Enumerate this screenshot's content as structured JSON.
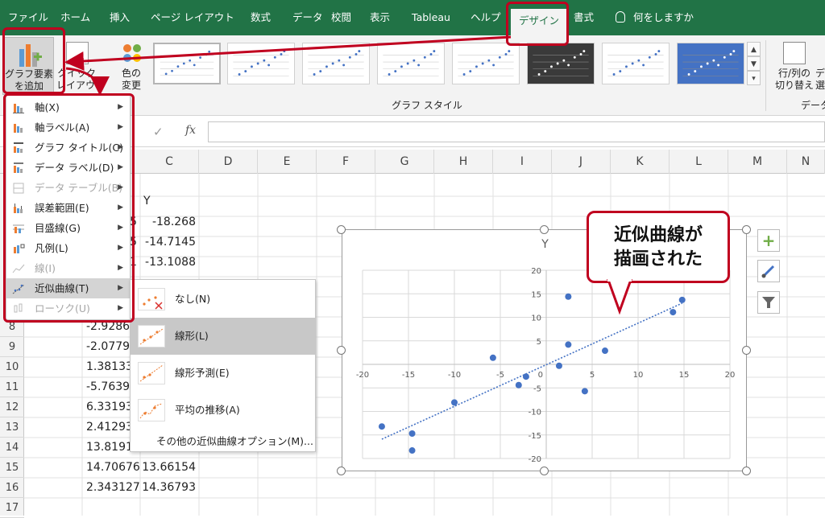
{
  "tabs": [
    {
      "label": "ファイル"
    },
    {
      "label": "ホーム"
    },
    {
      "label": "挿入"
    },
    {
      "label": "ページ レイアウト"
    },
    {
      "label": "数式"
    },
    {
      "label": "データ"
    },
    {
      "label": "校閲"
    },
    {
      "label": "表示"
    },
    {
      "label": "Tableau"
    },
    {
      "label": "ヘルプ"
    },
    {
      "label": "デザイン"
    },
    {
      "label": "書式"
    }
  ],
  "tell_me": "何をしますか",
  "ribbon": {
    "add_element": "グラフ要素\nを追加",
    "quick_layout": "クイック\nレイアウト",
    "change_colors": "色の\n変更",
    "styles_group": "グラフ スタイル",
    "switch_row_col": "行/列の\n切り替え",
    "select_data": "デ\n選",
    "data_group": "データ"
  },
  "formula": {
    "fx": "fx"
  },
  "columns": [
    "C",
    "D",
    "E",
    "F",
    "G",
    "H",
    "I",
    "J",
    "K",
    "L",
    "M",
    "N"
  ],
  "rows": [
    "8",
    "9",
    "10",
    "11",
    "12",
    "13",
    "14",
    "15",
    "16",
    "17"
  ],
  "cells": {
    "c_header": "Y",
    "b_partial": [
      "5",
      "5",
      "1"
    ],
    "c_values": [
      "-18.268",
      "-14.7145",
      "-13.1088"
    ],
    "b_values": [
      "-2.9286",
      "-2.0779",
      "1.38133",
      "-5.7639",
      "6.33193",
      "2.41293",
      "13.8191",
      "14.70676",
      "2.343127"
    ],
    "c_values_lower": [
      "13.66154",
      "14.36793"
    ]
  },
  "menu": {
    "items": [
      {
        "label": "軸(X)",
        "disabled": false
      },
      {
        "label": "軸ラベル(A)",
        "disabled": false
      },
      {
        "label": "グラフ タイトル(C)",
        "disabled": false
      },
      {
        "label": "データ ラベル(D)",
        "disabled": false
      },
      {
        "label": "データ テーブル(B)",
        "disabled": true
      },
      {
        "label": "誤差範囲(E)",
        "disabled": false
      },
      {
        "label": "目盛線(G)",
        "disabled": false
      },
      {
        "label": "凡例(L)",
        "disabled": false
      },
      {
        "label": "線(I)",
        "disabled": true
      },
      {
        "label": "近似曲線(T)",
        "disabled": false
      },
      {
        "label": "ローソク(U)",
        "disabled": true
      }
    ]
  },
  "submenu": {
    "items": [
      {
        "label": "なし(N)"
      },
      {
        "label": "線形(L)"
      },
      {
        "label": "線形予測(E)"
      },
      {
        "label": "平均の推移(A)"
      }
    ],
    "more": "その他の近似曲線オプション(M)..."
  },
  "callout": {
    "line1": "近似曲線が",
    "line2": "描画された"
  },
  "colors": {
    "accent": "#217346",
    "highlight": "#c0001f",
    "marker": "#4472c4"
  },
  "chart_data": {
    "type": "scatter",
    "title": "Y",
    "xlim": [
      -20,
      20
    ],
    "ylim": [
      -20,
      20
    ],
    "xticks": [
      -20,
      -15,
      -10,
      -5,
      0,
      5,
      10,
      15,
      20
    ],
    "yticks": [
      -20,
      -15,
      -10,
      -5,
      0,
      5,
      10,
      15,
      20
    ],
    "points": [
      [
        -17.9,
        -13.2
      ],
      [
        -14.6,
        -14.7
      ],
      [
        -14.6,
        -18.3
      ],
      [
        -10.0,
        -8.1
      ],
      [
        -5.8,
        1.4
      ],
      [
        -3.0,
        -4.4
      ],
      [
        -2.2,
        -2.6
      ],
      [
        1.4,
        -0.3
      ],
      [
        2.4,
        14.4
      ],
      [
        2.4,
        4.2
      ],
      [
        4.2,
        -5.7
      ],
      [
        6.4,
        2.9
      ],
      [
        13.8,
        11.1
      ],
      [
        14.8,
        13.7
      ]
    ],
    "trendline": {
      "type": "linear",
      "from": [
        -17.9,
        -15.9
      ],
      "to": [
        14.8,
        13.0
      ]
    }
  }
}
